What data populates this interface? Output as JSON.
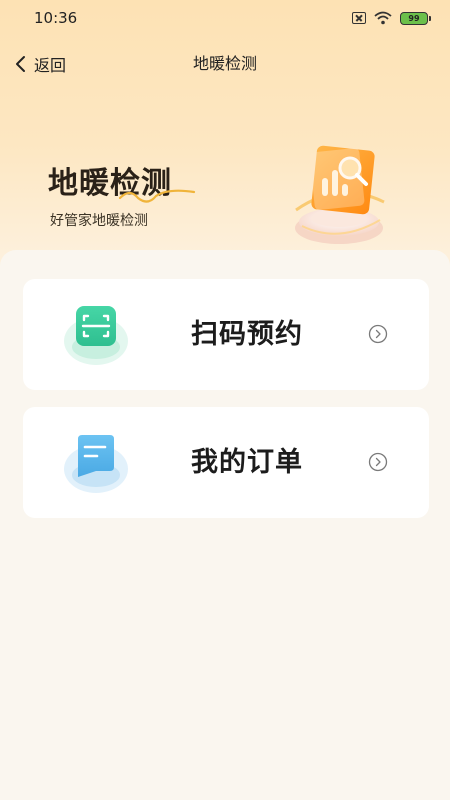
{
  "status_bar": {
    "time": "10:36",
    "battery": "99",
    "icons": [
      "sim-off-icon",
      "wifi-icon",
      "battery-icon"
    ]
  },
  "nav": {
    "back_label": "返回",
    "title": "地暖检测",
    "back_icon": "chevron-left-icon"
  },
  "hero": {
    "title": "地暖检测",
    "subtitle": "好管家地暖检测",
    "illustration": "chart-magnifier-illustration"
  },
  "cards": [
    {
      "label": "扫码预约",
      "icon": "scan-qr-icon",
      "arrow": "circle-chevron-right-icon",
      "accent": "#3fcf9f"
    },
    {
      "label": "我的订单",
      "icon": "order-list-icon",
      "arrow": "circle-chevron-right-icon",
      "accent": "#5ab6ea"
    }
  ],
  "colors": {
    "header_gradient_top": "#fde2b4",
    "background": "#faf6ef",
    "card": "#ffffff",
    "swoosh": "#f0b43a",
    "illustration_orange": "#ff9a1f"
  }
}
